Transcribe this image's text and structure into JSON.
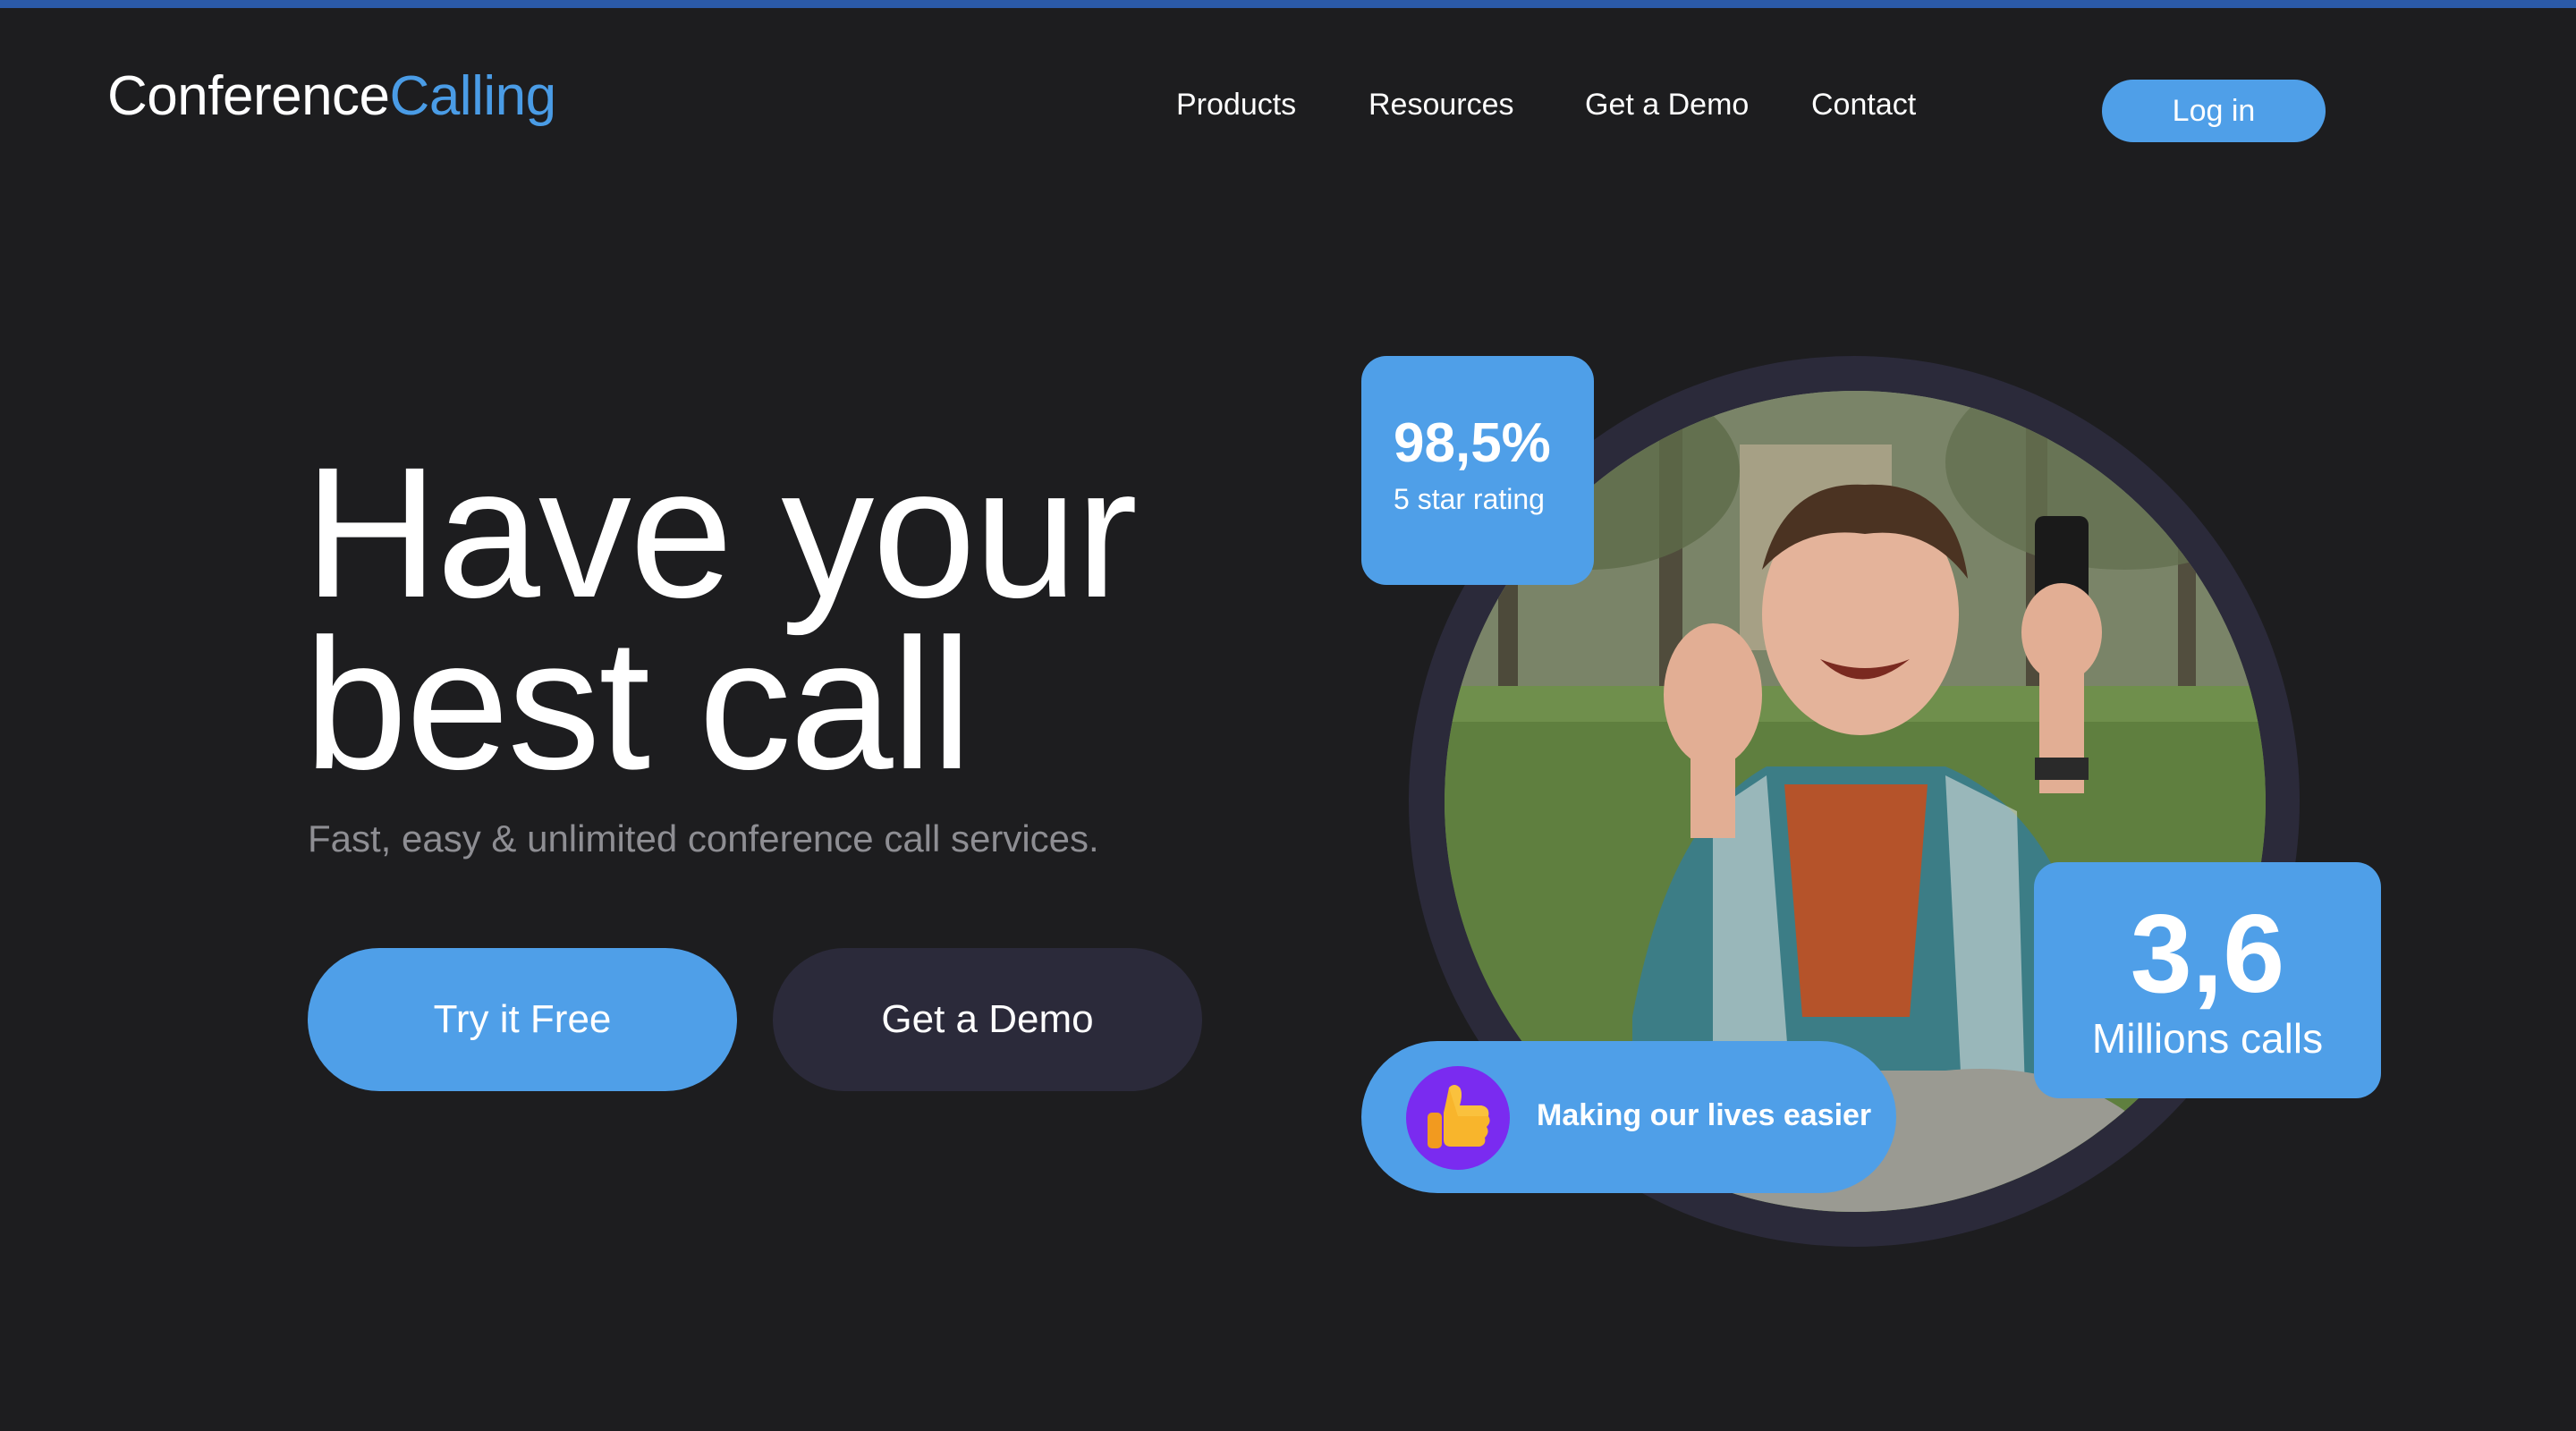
{
  "brand": {
    "name_part1": "Conference",
    "name_part2": "Calling",
    "accent_color": "#4a9ce6"
  },
  "nav": {
    "items": [
      "Products",
      "Resources",
      "Get a Demo",
      "Contact"
    ],
    "login_label": "Log in"
  },
  "hero": {
    "headline_line1": "Have your",
    "headline_line2": "best call",
    "subheadline": "Fast, easy & unlimited conference call services.",
    "primary_cta": "Try it Free",
    "secondary_cta": "Get a Demo",
    "image_icon": "person-video-call-photo"
  },
  "stats": {
    "rating_value": "98,5%",
    "rating_label": "5 star rating",
    "calls_value": "3,6",
    "calls_label": "Millions calls",
    "pill_text": "Making our lives easier",
    "pill_icon": "thumbs-up-icon"
  },
  "colors": {
    "background": "#1d1d1f",
    "primary": "#4f9fe8",
    "secondary_button": "#2b2a3a",
    "subtext": "#8e8e93",
    "pill_icon_bg": "#7a2bf0",
    "top_accent": "#2b5aa8"
  }
}
